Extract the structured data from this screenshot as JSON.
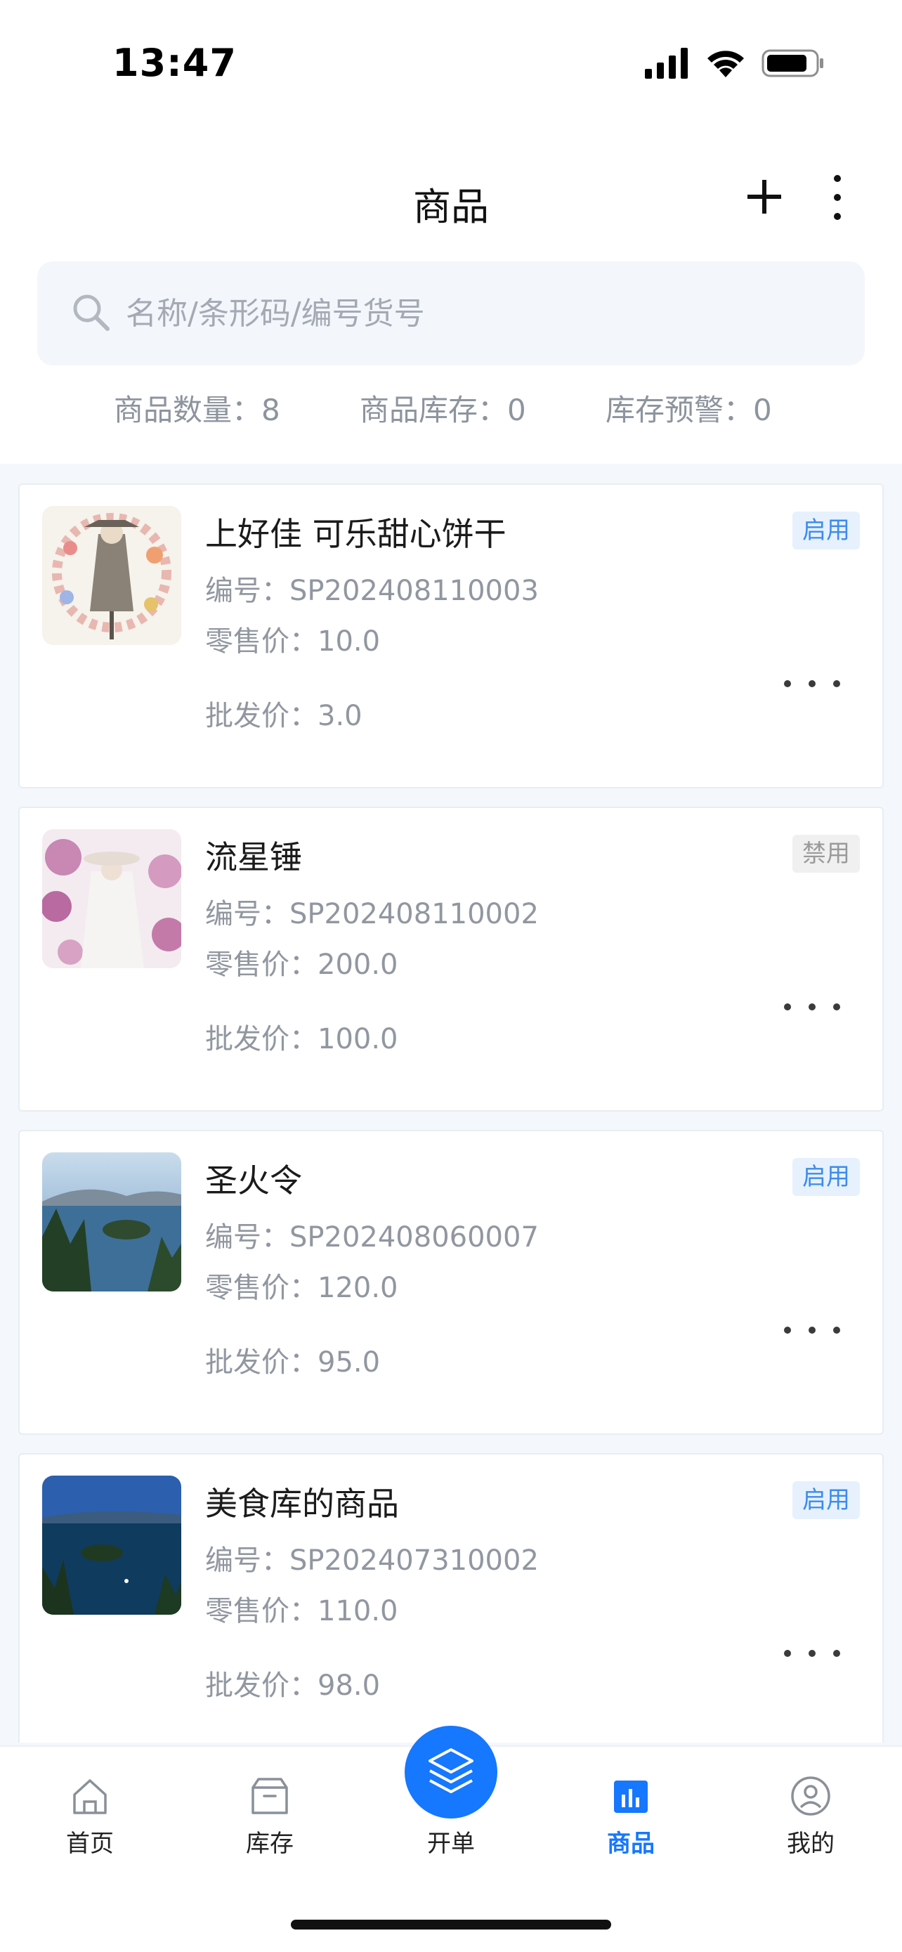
{
  "status_bar": {
    "time": "13:47"
  },
  "header": {
    "title": "商品"
  },
  "search": {
    "placeholder": "名称/条形码/编号货号"
  },
  "stats": {
    "count": "商品数量：8",
    "stock": "商品库存：0",
    "warning": "库存预警：0"
  },
  "products": [
    {
      "name": "上好佳 可乐甜心饼干",
      "code": "编号：SP202408110003",
      "retail": "零售价：10.0",
      "wholesale": "批发价：3.0",
      "status": "启用",
      "status_color": "#3d8bec"
    },
    {
      "name": "流星锤",
      "code": "编号：SP202408110002",
      "retail": "零售价：200.0",
      "wholesale": "批发价：100.0",
      "status": "禁用",
      "status_color": "#9a9a9a"
    },
    {
      "name": "圣火令",
      "code": "编号：SP202408060007",
      "retail": "零售价：120.0",
      "wholesale": "批发价：95.0",
      "status": "启用",
      "status_color": "#3d8bec"
    },
    {
      "name": "美食库的商品",
      "code": "编号：SP202407310002",
      "retail": "零售价：110.0",
      "wholesale": "批发价：98.0",
      "status": "启用",
      "status_color": "#3d8bec"
    }
  ],
  "tabbar": {
    "home": "首页",
    "inventory": "库存",
    "order": "开单",
    "products": "商品",
    "mine": "我的",
    "accent": "#1677ff"
  }
}
